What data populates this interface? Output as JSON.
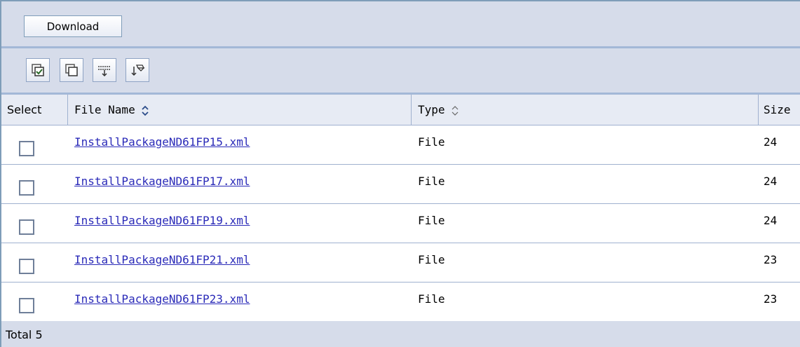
{
  "toolbar": {
    "download_label": "Download"
  },
  "icon_toolbar": [
    {
      "name": "select-all-icon"
    },
    {
      "name": "deselect-all-icon"
    },
    {
      "name": "show-filter-icon"
    },
    {
      "name": "clear-filter-icon"
    }
  ],
  "table": {
    "columns": {
      "select": "Select",
      "file_name": "File Name",
      "type": "Type",
      "size": "Size"
    },
    "rows": [
      {
        "file_name": "InstallPackageND61FP15.xml",
        "type": "File",
        "size": "24"
      },
      {
        "file_name": "InstallPackageND61FP17.xml",
        "type": "File",
        "size": "24"
      },
      {
        "file_name": "InstallPackageND61FP19.xml",
        "type": "File",
        "size": "24"
      },
      {
        "file_name": "InstallPackageND61FP21.xml",
        "type": "File",
        "size": "23"
      },
      {
        "file_name": "InstallPackageND61FP23.xml",
        "type": "File",
        "size": "23"
      }
    ],
    "total_label": "Total 5"
  },
  "colors": {
    "link": "#2a2ab8",
    "toolbar_bg": "#d6dcea",
    "border": "#9fb1cf"
  }
}
